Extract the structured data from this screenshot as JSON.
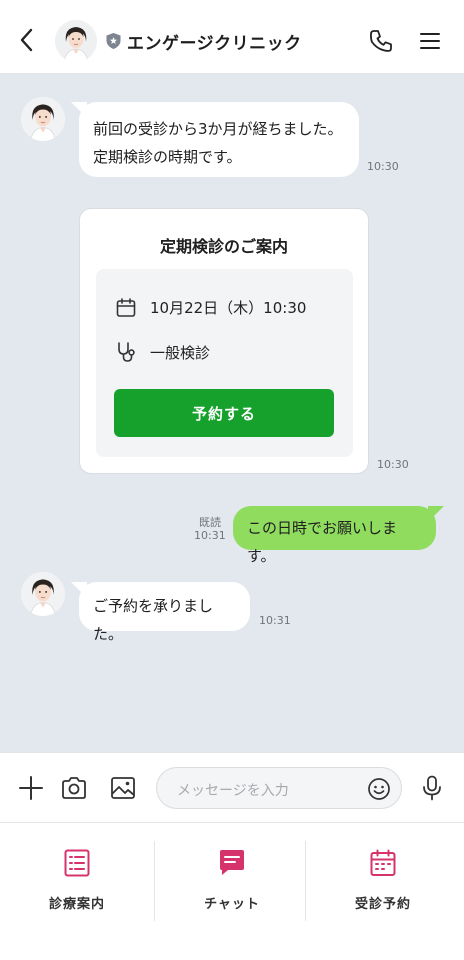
{
  "header": {
    "title": "エンゲージクリニック"
  },
  "messages": [
    {
      "line1": "前回の受診から3か月が経ちました。",
      "line2": "定期検診の時期です。",
      "time": "10:30"
    },
    {
      "time": "10:30"
    },
    {
      "text": "この日時でお願いします。",
      "read": "既読",
      "time": "10:31"
    },
    {
      "text": "ご予約を承りました。",
      "time": "10:31"
    }
  ],
  "card": {
    "title": "定期検診のご案内",
    "datetime": "10月22日（木）10:30",
    "type": "一般検診",
    "button": "予約する"
  },
  "input": {
    "placeholder": "メッセージを入力"
  },
  "nav": [
    {
      "label": "診療案内",
      "icon": "list-icon"
    },
    {
      "label": "チャット",
      "icon": "chat-icon"
    },
    {
      "label": "受診予約",
      "icon": "calendar-icon"
    }
  ],
  "colors": {
    "accent": "#16a12d",
    "bubble_self": "#8fdc5f",
    "chat_bg": "#e3e8ef",
    "nav_icon": "#d6336c"
  }
}
